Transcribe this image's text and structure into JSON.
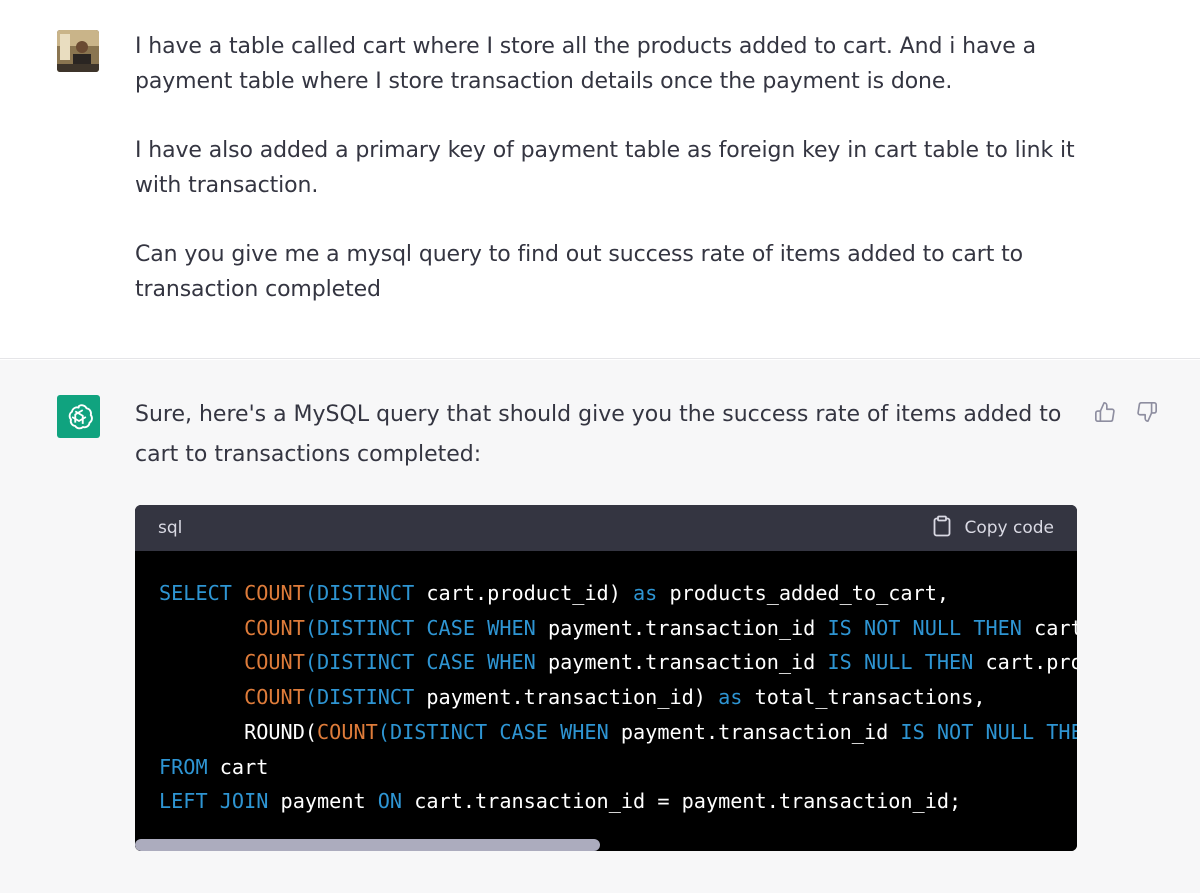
{
  "user_message": {
    "paragraphs": [
      "I have a table called cart where I store all the products added to cart. And i have a payment table where I store transaction details once the payment is done.",
      "I have also added a primary key of payment table as foreign key in cart table to link it with transaction.",
      "Can you give me a mysql query to find out success rate of items added to cart to transaction completed"
    ]
  },
  "assistant_message": {
    "intro": "Sure, here's a MySQL query that should give you the success rate of items added to cart to transactions completed:",
    "code": {
      "language": "sql",
      "copy_label": "Copy code",
      "lines": [
        [
          [
            "kw",
            "SELECT "
          ],
          [
            "fn2",
            "COUNT"
          ],
          [
            "kw",
            "(DISTINCT "
          ],
          [
            "tx",
            "cart.product_id) "
          ],
          [
            "kw",
            "as "
          ],
          [
            "tx",
            "products_added_to_cart,"
          ]
        ],
        [
          [
            "tx",
            "       "
          ],
          [
            "fn2",
            "COUNT"
          ],
          [
            "kw",
            "(DISTINCT CASE WHEN "
          ],
          [
            "tx",
            "payment.transaction_id "
          ],
          [
            "kw",
            "IS NOT NULL THEN "
          ],
          [
            "tx",
            "cart"
          ]
        ],
        [
          [
            "tx",
            "       "
          ],
          [
            "fn2",
            "COUNT"
          ],
          [
            "kw",
            "(DISTINCT CASE WHEN "
          ],
          [
            "tx",
            "payment.transaction_id "
          ],
          [
            "kw",
            "IS NULL THEN "
          ],
          [
            "tx",
            "cart.pro"
          ]
        ],
        [
          [
            "tx",
            "       "
          ],
          [
            "fn2",
            "COUNT"
          ],
          [
            "kw",
            "(DISTINCT "
          ],
          [
            "tx",
            "payment.transaction_id) "
          ],
          [
            "kw",
            "as "
          ],
          [
            "tx",
            "total_transactions,"
          ]
        ],
        [
          [
            "tx",
            "       ROUND("
          ],
          [
            "fn2",
            "COUNT"
          ],
          [
            "kw",
            "(DISTINCT CASE WHEN "
          ],
          [
            "tx",
            "payment.transaction_id "
          ],
          [
            "kw",
            "IS NOT NULL THE"
          ]
        ],
        [
          [
            "kw",
            "FROM "
          ],
          [
            "tx",
            "cart"
          ]
        ],
        [
          [
            "kw",
            "LEFT JOIN "
          ],
          [
            "tx",
            "payment "
          ],
          [
            "kw",
            "ON "
          ],
          [
            "tx",
            "cart.transaction_id = payment.transaction_id;"
          ]
        ]
      ]
    }
  },
  "colors": {
    "keyword": "#2e95d3",
    "function": "#df7c3a",
    "accent_bot": "#10a37f"
  },
  "icons": [
    "user-avatar",
    "openai-logo-icon",
    "thumbs-up-icon",
    "thumbs-down-icon",
    "clipboard-icon"
  ]
}
